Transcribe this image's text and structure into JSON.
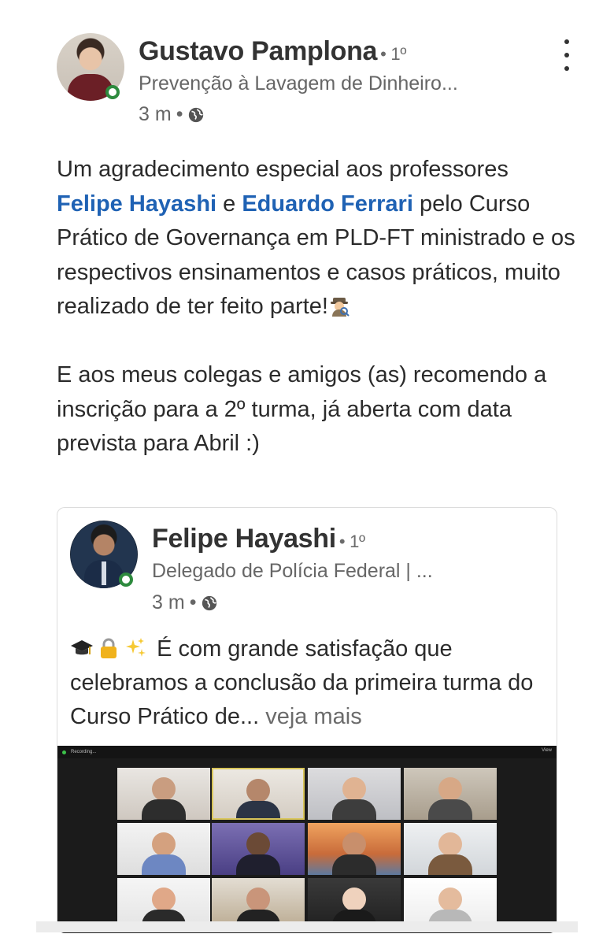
{
  "post": {
    "author_name": "Gustavo Pamplona",
    "author_degree": "• 1º",
    "author_headline": "Prevenção à Lavagem de Dinheiro...",
    "time": "3 m",
    "meta_sep": "•",
    "text": {
      "p1_a": "Um agradecimento especial aos professores ",
      "mention_1": "Felipe Hayashi",
      "p1_b": " e ",
      "mention_2": "Eduardo Ferrari",
      "p1_c": " pelo Curso Prático de Governança em PLD-FT ministrado e os respectivos ensinamentos e casos práticos, muito realizado de ter feito parte!",
      "p2": "E aos meus colegas e amigos (as) recomendo a inscrição para a 2º turma, já aberta com data prevista para Abril :)"
    }
  },
  "shared": {
    "author_name": "Felipe Hayashi",
    "author_degree": "• 1º",
    "author_headline": "Delegado de Polícia Federal | ...",
    "time": "3 m",
    "meta_sep": "•",
    "text": "É com grande satisfação que celebramos a conclusão da primeira turma do Curso Prático de...",
    "see_more": "veja mais"
  },
  "icons": {
    "more": "more-vertical-icon",
    "globe": "globe-icon",
    "online": "online-status-icon",
    "spy": "detective-emoji-icon",
    "grad_cap": "graduation-cap-emoji-icon",
    "lock": "lock-emoji-icon",
    "sparkles": "sparkles-emoji-icon"
  },
  "colors": {
    "mention": "#1f62b4",
    "online": "#2d8a3e",
    "text": "#2b2b2b",
    "secondary": "#666666"
  },
  "call": {
    "recording_label": "Recording...",
    "view_label": "View"
  }
}
